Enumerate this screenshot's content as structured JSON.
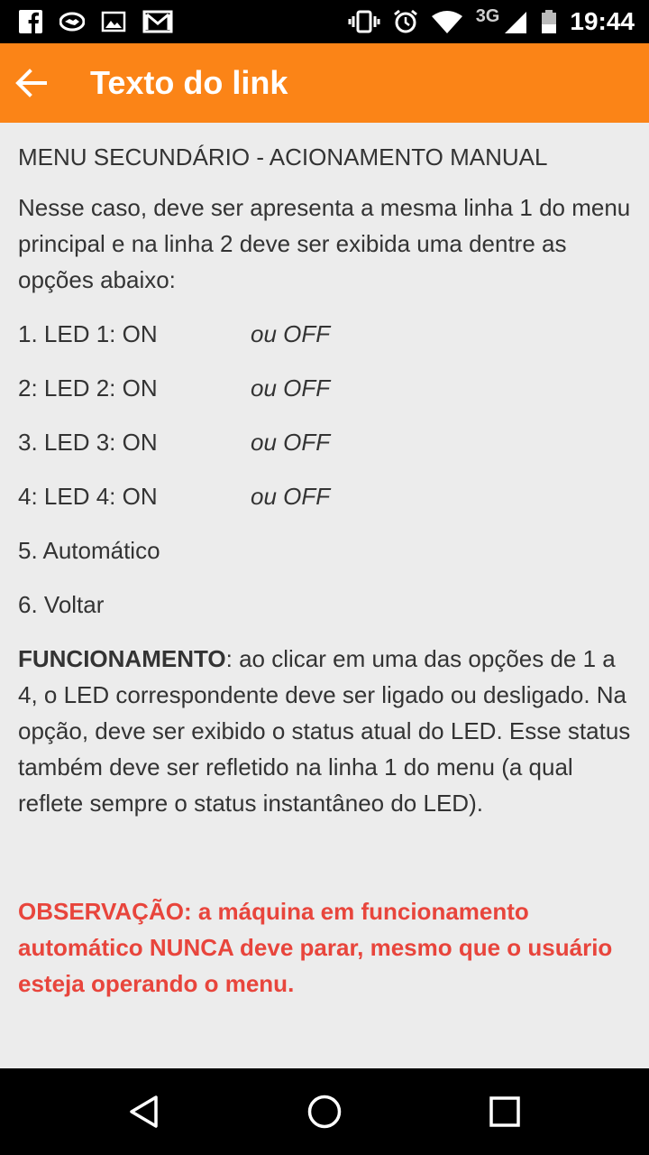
{
  "status_bar": {
    "network": "3G",
    "time": "19:44",
    "left_icons": [
      "facebook-icon",
      "handshake-icon",
      "image-icon",
      "gmail-icon"
    ],
    "right_icons": [
      "vibrate-icon",
      "alarm-icon",
      "wifi-icon",
      "signal-icon",
      "battery-icon"
    ]
  },
  "app_bar": {
    "title": "Texto do link",
    "back_icon": "arrow-back-icon",
    "color": "#fb8417"
  },
  "content": {
    "heading": "MENU SECUNDÁRIO - ACIONAMENTO MANUAL",
    "intro": "Nesse caso, deve ser apresenta a mesma linha 1 do menu principal e na linha 2 deve ser exibida uma dentre as opções abaixo:",
    "options": [
      {
        "label": "1. LED 1: ON",
        "alt": "ou OFF"
      },
      {
        "label": "2: LED 2: ON",
        "alt": "ou OFF"
      },
      {
        "label": "3. LED 3: ON",
        "alt": "ou OFF"
      },
      {
        "label": "4: LED 4: ON",
        "alt": "ou OFF"
      },
      {
        "label": "5. Automático",
        "alt": ""
      },
      {
        "label": "6. Voltar",
        "alt": ""
      }
    ],
    "func_label": "FUNCIONAMENTO",
    "func_text": ": ao clicar em uma das opções de 1 a 4, o LED correspondente deve ser ligado ou desligado. Na opção, deve ser exibido o status atual do LED. Esse status também deve ser refletido na linha 1 do menu (a qual reflete sempre o status instantâneo do LED).",
    "note": "OBSERVAÇÃO: a máquina em funcionamento automático NUNCA deve parar, mesmo que o usuário esteja operando o menu.",
    "note_color": "#e8453c"
  },
  "nav_bar": {
    "icons": [
      "back-triangle-icon",
      "home-circle-icon",
      "recents-square-icon"
    ]
  }
}
